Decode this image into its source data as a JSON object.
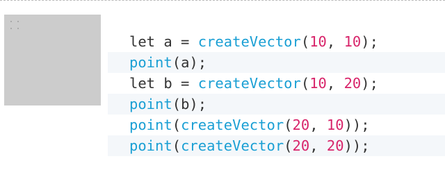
{
  "code": {
    "lines": [
      {
        "kw": "let ",
        "var": "a",
        "eq": " = ",
        "fn": "createVector",
        "open": "(",
        "n1": "10",
        "sep": ", ",
        "n2": "10",
        "close": ");"
      },
      {
        "fn": "point",
        "open": "(",
        "arg": "a",
        "close": ");"
      },
      {
        "kw": "let ",
        "var": "b",
        "eq": " = ",
        "fn": "createVector",
        "open": "(",
        "n1": "10",
        "sep": ", ",
        "n2": "20",
        "close": ");"
      },
      {
        "fn": "point",
        "open": "(",
        "arg": "b",
        "close": ");"
      },
      {
        "fn": "point",
        "open": "(",
        "fn2": "createVector",
        "open2": "(",
        "n1": "20",
        "sep": ", ",
        "n2": "10",
        "close": "));"
      },
      {
        "fn": "point",
        "open": "(",
        "fn2": "createVector",
        "open2": "(",
        "n1": "20",
        "sep": ", ",
        "n2": "20",
        "close": "));"
      }
    ]
  },
  "preview": {
    "points": [
      {
        "x": 10,
        "y": 10
      },
      {
        "x": 10,
        "y": 20
      },
      {
        "x": 20,
        "y": 10
      },
      {
        "x": 20,
        "y": 20
      }
    ]
  },
  "colors": {
    "function": "#1a9fd4",
    "number": "#d8246a",
    "text": "#333333",
    "canvas": "#cccccc",
    "alt_row": "#f4f7fa"
  }
}
